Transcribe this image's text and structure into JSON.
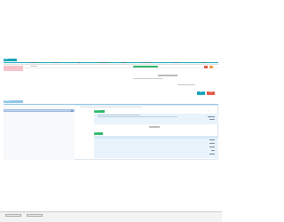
{
  "colors": {
    "teal": "#16a3b8",
    "red": "#e45a4a",
    "green": "#2fb86b",
    "light_blue": "#e8f3fb",
    "light_green": "#d8f2df",
    "pink": "#f6c3cc"
  },
  "top_panel": {
    "tag_label": "Bill list",
    "columns": [
      "",
      "Document date",
      "Number",
      "Type",
      "Settlement method",
      "Amount",
      "Settlement details",
      "Tax rate",
      "Status"
    ],
    "rows": [
      {
        "cells": [
          "",
          "2021-03-01",
          "1",
          "",
          "",
          "",
          "",
          "",
          ""
        ]
      },
      {
        "cells": [
          "",
          "",
          "",
          "",
          "",
          "",
          "",
          "",
          ""
        ]
      }
    ],
    "note": "",
    "link_label": "Unit details",
    "buttons": {
      "save": "Save",
      "cancel": "Cancel"
    }
  },
  "bottom_panel": {
    "tag_label": "Details list",
    "info_label": "Basic info",
    "search_placeholder": "",
    "summary_label": "Total",
    "section_label": "Items",
    "count_label": "1/1"
  },
  "taskbar": {
    "items": [
      "",
      ""
    ],
    "clock": ""
  }
}
